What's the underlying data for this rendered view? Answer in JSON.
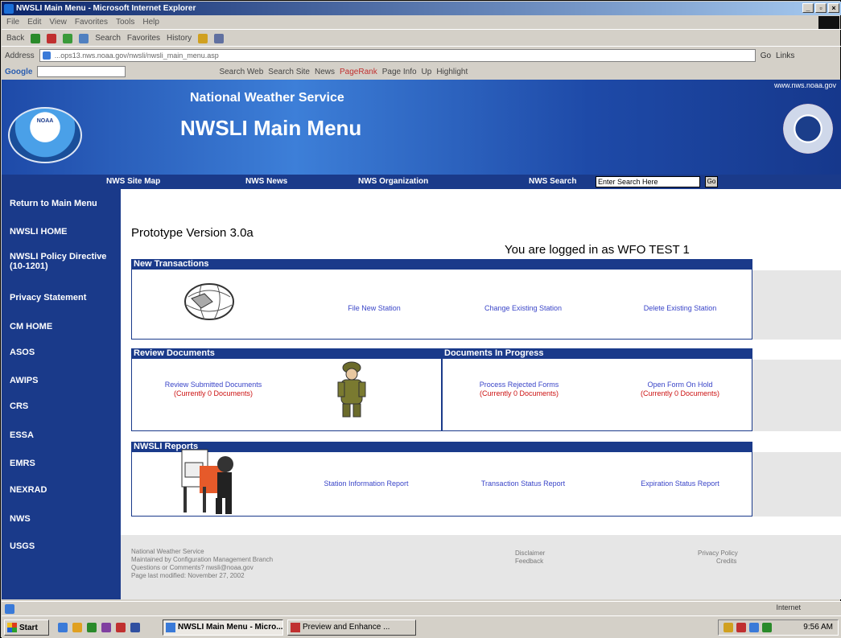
{
  "window": {
    "title": "NWSLI Main Menu - Microsoft Internet Explorer",
    "controls": [
      "_",
      "▫",
      "×"
    ]
  },
  "menubar": {
    "items": [
      "File",
      "Edit",
      "View",
      "Favorites",
      "Tools",
      "Help"
    ]
  },
  "toolbar": {
    "back": "Back",
    "search": "Search",
    "favorites": "Favorites",
    "history": "History"
  },
  "address": {
    "label": "Address",
    "url": "...ops13.nws.noaa.gov/nwsli/nwsli_main_menu.asp",
    "go": "Go",
    "links": "Links"
  },
  "google": {
    "label": "Google",
    "search_web": "Search Web",
    "search_site": "Search Site",
    "news": "News",
    "pagerank": "PageRank",
    "page_info": "Page Info",
    "up": "Up",
    "highlight": "Highlight"
  },
  "header": {
    "url": "www.nws.noaa.gov",
    "subtitle": "National Weather Service",
    "title": "NWSLI Main Menu",
    "noaa": "NOAA"
  },
  "nav": {
    "sitemap": "NWS Site Map",
    "news": "NWS News",
    "org": "NWS Organization",
    "search_label": "NWS Search",
    "search_value": "Enter Search Here",
    "go": "Go"
  },
  "sidebar": {
    "items": [
      "Return to Main Menu",
      "NWSLI HOME",
      "NWSLI Policy Directive (10-1201)",
      "Privacy Statement",
      "CM HOME",
      "ASOS",
      "AWIPS",
      "CRS",
      "ESSA",
      "EMRS",
      "NEXRAD",
      "NWS",
      "USGS"
    ]
  },
  "main": {
    "version": "Prototype Version 3.0a",
    "logged_in": "You are logged in as WFO TEST 1",
    "new_transactions": {
      "heading": "New Transactions",
      "links": [
        "File New Station",
        "Change Existing Station",
        "Delete Existing Station"
      ]
    },
    "review_documents": {
      "heading": "Review Documents",
      "link": "Review Submitted Documents",
      "count": "(Currently 0 Documents)"
    },
    "in_progress": {
      "heading": "Documents In Progress",
      "rejected": "Process Rejected Forms",
      "rejected_count": "(Currently 0 Documents)",
      "hold": "Open Form On Hold",
      "hold_count": "(Currently 0 Documents)"
    },
    "reports": {
      "heading": "NWSLI Reports",
      "links": [
        "Station Information Report",
        "Transaction Status Report",
        "Expiration Status Report"
      ]
    },
    "footer": {
      "lines": [
        "National Weather Service",
        "Maintained by Configuration Management Branch",
        "Questions or Comments? nwsli@noaa.gov",
        "Page last modified: November 27, 2002"
      ],
      "disclaimer": "Disclaimer",
      "feedback": "Feedback",
      "privacy": "Privacy Policy",
      "credits": "Credits"
    }
  },
  "statusbar": {
    "zone": "Internet"
  },
  "taskbar": {
    "start": "Start",
    "tasks": [
      "NWSLI Main Menu - Micro...",
      "Preview and Enhance ..."
    ],
    "clock": "9:56 AM"
  }
}
